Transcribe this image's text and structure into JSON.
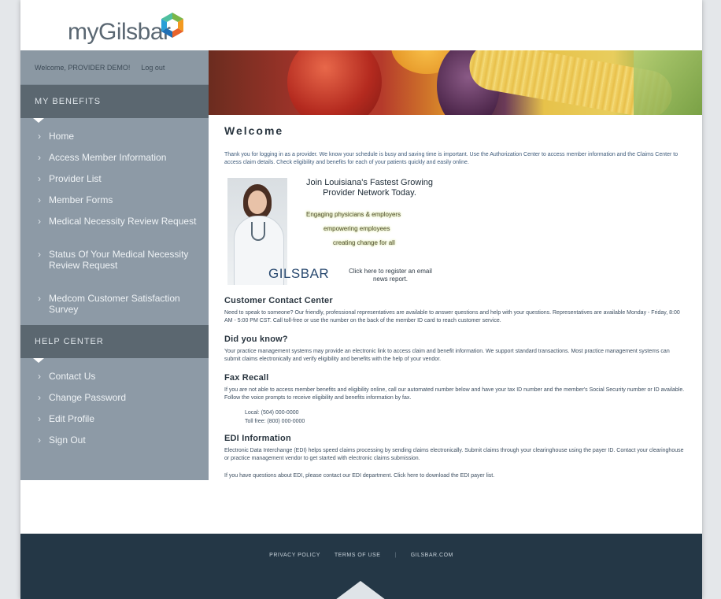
{
  "header": {
    "logo_text": "myGilsbar"
  },
  "sidebar": {
    "welcome_text": "Welcome, PROVIDER DEMO!",
    "logout_label": "Log out",
    "benefits_heading": "MY BENEFITS",
    "benefits_items": [
      {
        "label": "Home"
      },
      {
        "label": "Access Member Information"
      },
      {
        "label": "Provider List"
      },
      {
        "label": "Member Forms"
      },
      {
        "label": "Medical Necessity Review Request"
      },
      {
        "label": "Status Of Your Medical Necessity Review Request"
      },
      {
        "label": "Medcom Customer Satisfaction Survey"
      }
    ],
    "help_heading": "HELP CENTER",
    "help_items": [
      {
        "label": "Contact Us"
      },
      {
        "label": "Change Password"
      },
      {
        "label": "Edit Profile"
      },
      {
        "label": "Sign Out"
      }
    ]
  },
  "main": {
    "title": "Welcome",
    "intro_text": "Thank you for logging in as a provider. We know your schedule is busy and saving time is important. Use the Authorization Center to access member information and the Claims Center to access claim details. Check eligibility and benefits for each of your patients quickly and easily online.",
    "promo": {
      "headline": "Join Louisiana's Fastest Growing Provider Network Today.",
      "line1": "Engaging physicians & employers",
      "line2": "empowering employees",
      "line3": "creating change for all",
      "logo": "GILSBAR",
      "click_text": "Click here to register an email news report."
    },
    "customer_contact": {
      "heading": "Customer Contact Center",
      "text": "Need to speak to someone? Our friendly, professional representatives are available to answer questions and help with your questions. Representatives are available Monday - Friday, 8:00 AM - 5:00 PM CST. Call toll-free or use the number on the back of the member ID card to reach customer service."
    },
    "did_you_know": {
      "heading": "Did you know?",
      "text": "Your practice management systems may provide an electronic link to access claim and benefit information. We support standard transactions. Most practice management systems can submit claims electronically and verify eligibility and benefits with the help of your vendor."
    },
    "fax_recall": {
      "heading": "Fax Recall",
      "text": "If you are not able to access member benefits and eligibility online, call our automated number below and have your tax ID number and the member's Social Security number or ID available. Follow the voice prompts to receive eligibility and benefits information by fax.",
      "items": [
        "Local: (504) 000-0000",
        "Toll free: (800) 000-0000"
      ]
    },
    "edi_info": {
      "heading": "EDI Information",
      "text": "Electronic Data Interchange (EDI) helps speed claims processing by sending claims electronically. Submit claims through your clearinghouse using the payer ID. Contact your clearinghouse or practice management vendor to get started with electronic claims submission.",
      "text2": "If you have questions about EDI, please contact our EDI department. Click here to download the EDI payer list."
    }
  },
  "footer": {
    "links": [
      "PRIVACY POLICY",
      "TERMS OF USE",
      "GILSBAR.COM"
    ]
  },
  "colors": {
    "sidebar_bg": "#8d9aa6",
    "section_head_bg": "#5b6770",
    "footer_bg": "#243746"
  }
}
